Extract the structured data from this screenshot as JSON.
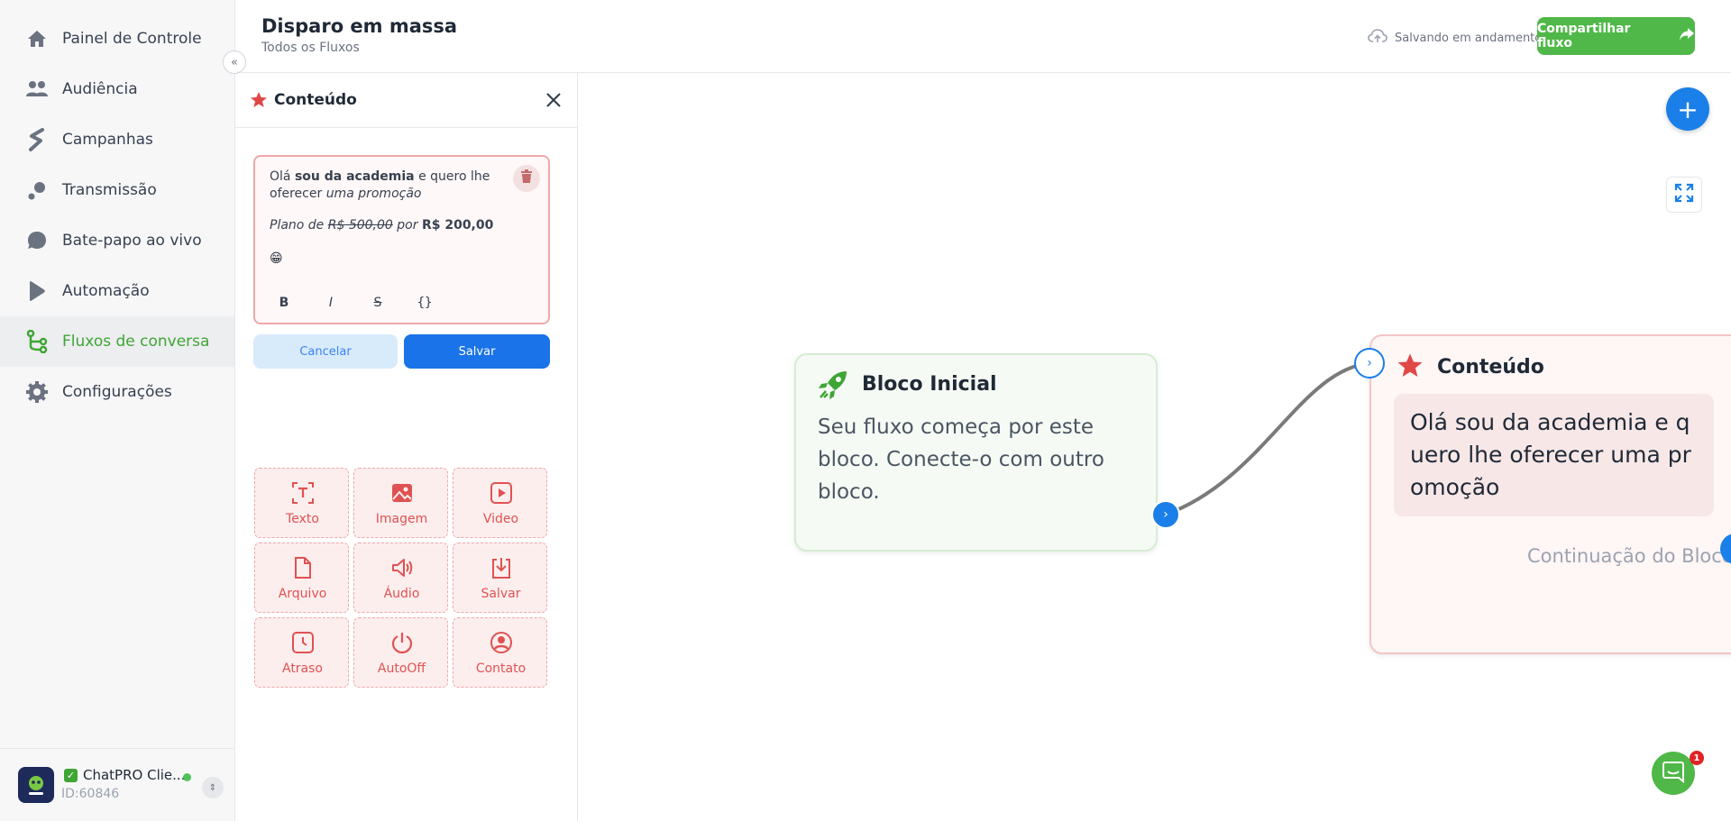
{
  "sidebar": {
    "items": [
      {
        "label": "Painel de Controle",
        "icon": "home-icon"
      },
      {
        "label": "Audiência",
        "icon": "users-icon"
      },
      {
        "label": "Campanhas",
        "icon": "campaign-icon"
      },
      {
        "label": "Transmissão",
        "icon": "broadcast-icon"
      },
      {
        "label": "Bate-papo ao vivo",
        "icon": "chat-bubble-icon"
      },
      {
        "label": "Automação",
        "icon": "play-icon"
      },
      {
        "label": "Fluxos de conversa",
        "icon": "flow-icon"
      },
      {
        "label": "Configurações",
        "icon": "gear-icon"
      }
    ],
    "active_item": "Fluxos de conversa",
    "account": {
      "name": "ChatPRO Clie...",
      "id": "ID:60846"
    }
  },
  "header": {
    "title": "Disparo em massa",
    "subtitle": "Todos os Fluxos",
    "status": "Salvando em andamento",
    "share_label": "Compartilhar fluxo"
  },
  "panel": {
    "title": "Conteúdo",
    "editor": {
      "line1_a": "Olá ",
      "line1_bold": "sou da academia",
      "line1_b": " e quero lhe oferecer ",
      "line1_italic": "uma promoção",
      "line2_a": "Plano de ",
      "line2_strike": "R$ 500,00",
      "line2_b": " por ",
      "line2_bold": "R$ 200,00",
      "emoji": "😁",
      "toolbar": [
        "B",
        "I",
        "S",
        "{}"
      ]
    },
    "cancel_label": "Cancelar",
    "save_label": "Salvar",
    "tools": [
      {
        "label": "Texto",
        "icon": "text-icon"
      },
      {
        "label": "Imagem",
        "icon": "image-icon"
      },
      {
        "label": "Video",
        "icon": "video-icon"
      },
      {
        "label": "Arquivo",
        "icon": "file-icon"
      },
      {
        "label": "Áudio",
        "icon": "audio-icon"
      },
      {
        "label": "Salvar",
        "icon": "download-icon"
      },
      {
        "label": "Atraso",
        "icon": "clock-icon"
      },
      {
        "label": "AutoOff",
        "icon": "power-icon"
      },
      {
        "label": "Contato",
        "icon": "contact-icon"
      }
    ]
  },
  "canvas": {
    "start_block": {
      "title": "Bloco Inicial",
      "text": "Seu fluxo começa por este bloco. Conecte-o com outro bloco."
    },
    "content_block": {
      "title": "Conteúdo",
      "message": "Olá sou da academia e quero lhe oferecer uma promoção",
      "continuation": "Continuação do Bloco"
    },
    "notifications_count": "1"
  },
  "colors": {
    "brand_green": "#4fb848",
    "accent_blue": "#1a7fe8",
    "content_red": "#e05252"
  }
}
